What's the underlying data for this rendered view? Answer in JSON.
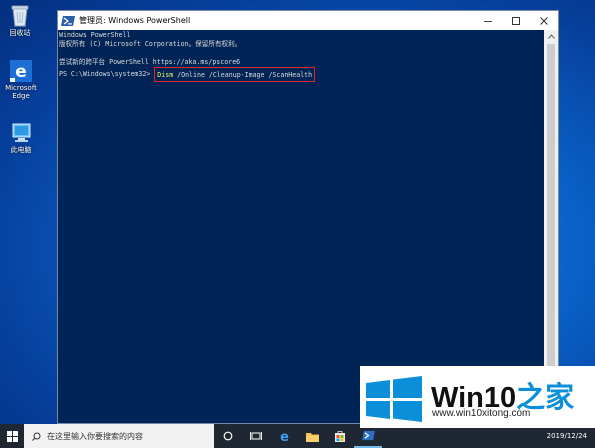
{
  "desktop": {
    "icons": [
      {
        "name": "recycle-bin",
        "label": "回收站"
      },
      {
        "name": "microsoft-edge",
        "label": "Microsoft Edge"
      },
      {
        "name": "this-pc",
        "label": "此电脑"
      }
    ]
  },
  "window": {
    "title": "管理员: Windows PowerShell",
    "console": {
      "lines": [
        "Windows PowerShell",
        "版权所有 (C) Microsoft Corporation。保留所有权利。",
        "",
        "尝试新的跨平台 PowerShell https://aka.ms/pscore6",
        ""
      ],
      "prompt": "PS C:\\Windows\\system32> ",
      "command_name": "Dism",
      "command_args": " /Online /Cleanup-Image /ScanHealth"
    },
    "highlight_color": "#e0252b"
  },
  "taskbar": {
    "search_placeholder": "在这里输入你要搜索的内容",
    "clock_text": "2019/12/24"
  },
  "watermark": {
    "brand_prefix": "Win10",
    "brand_suffix": "之家",
    "url": "www.win10xitong.com"
  },
  "colors": {
    "console_bg": "#012456",
    "console_text": "#dcdcdc",
    "command_yellow": "#f2f26a",
    "taskbar_bg": "#1f2733",
    "accent_blue": "#0a63c9"
  }
}
